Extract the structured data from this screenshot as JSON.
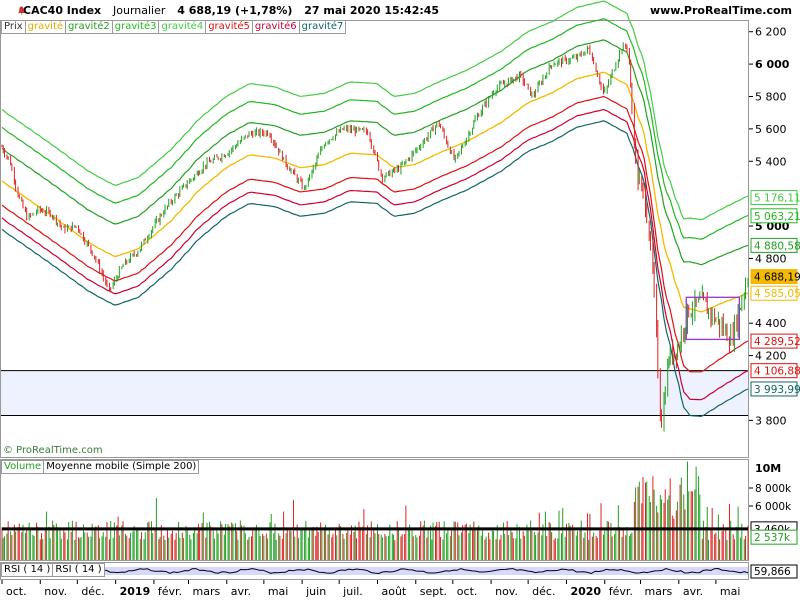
{
  "header": {
    "symbol": "CAC40 Index",
    "period": "Journalier",
    "last_price": "4 688,19 (+1,78%)",
    "datetime": "27 mai 2020 15:42:45",
    "site": "www.ProRealTime.com"
  },
  "price_legend": [
    {
      "label": "Prix",
      "color": "#333333"
    },
    {
      "label": "gravité",
      "color": "#e8a800"
    },
    {
      "label": "gravité2",
      "color": "#22a022"
    },
    {
      "label": "gravité3",
      "color": "#22b822"
    },
    {
      "label": "gravité4",
      "color": "#44cc44"
    },
    {
      "label": "gravité5",
      "color": "#dd1111"
    },
    {
      "label": "gravité6",
      "color": "#cc0033"
    },
    {
      "label": "gravité7",
      "color": "#116666"
    }
  ],
  "watermark": "© ProRealTime.com",
  "volume_legend": [
    {
      "label": "Volume",
      "color": "#22a022"
    },
    {
      "label": "Moyenne mobile (Simple 200)",
      "color": "#000000"
    }
  ],
  "rsi_legend": [
    {
      "label": "RSI ( 14 )",
      "color": "#000000"
    },
    {
      "label": "RSI ( 14 )",
      "color": "#000000"
    }
  ],
  "colors": {
    "bull": "#22a022",
    "bear": "#dd2222",
    "band_fill": "#eef2ff",
    "up3": "#44cc44",
    "up2": "#22b822",
    "up1": "#22a022",
    "mid": "#f5b800",
    "dn1": "#dd1111",
    "dn2": "#cc0033",
    "dn3": "#116666",
    "rsi_band": "#d8d8ff"
  },
  "chart_data": {
    "type": "line",
    "x_axis": {
      "labels": [
        "oct.",
        "nov.",
        "déc.",
        "2019",
        "févr.",
        "mars",
        "avr.",
        "mai",
        "juin",
        "juil.",
        "août",
        "sept.",
        "oct.",
        "nov.",
        "déc.",
        "2020",
        "févr.",
        "mars",
        "avr.",
        "mai"
      ],
      "bold_labels": [
        "2019",
        "2020"
      ],
      "range": [
        "2018-10-01",
        "2020-05-27"
      ]
    },
    "price_axis": {
      "ylim": [
        3580,
        6260
      ],
      "ticks": [
        "6 200",
        "6 000",
        "5 800",
        "5 600",
        "5 400",
        "5 000",
        "4 800",
        "4 400",
        "4 200",
        "3 800"
      ],
      "bold_ticks": [
        "6 000",
        "5 000"
      ]
    },
    "tags": [
      {
        "text": "5 176,11",
        "value": 5176.11,
        "color": "#44cc44"
      },
      {
        "text": "5 063,21",
        "value": 5063.21,
        "color": "#22b822"
      },
      {
        "text": "4 880,58",
        "value": 4880.58,
        "color": "#22a022"
      },
      {
        "text": "4 688,19",
        "value": 4688.19,
        "color": "#f5b800",
        "filled": true
      },
      {
        "text": "4 585,05",
        "value": 4585.05,
        "color": "#f5b800"
      },
      {
        "text": "4 289,52",
        "value": 4289.52,
        "color": "#dd1111"
      },
      {
        "text": "4 106,88",
        "value": 4106.88,
        "color": "#dd1111"
      },
      {
        "text": "3 993,99",
        "value": 3993.99,
        "color": "#116666"
      }
    ],
    "support_zone": {
      "upper": 4106.88,
      "lower": 3830
    },
    "box": {
      "from": "2020-04-07",
      "to": "2020-05-20",
      "high": 4560,
      "low": 4300
    },
    "central_line": {
      "name": "gravité",
      "points": [
        [
          "2018-10-01",
          5280
        ],
        [
          "2018-10-20",
          5180
        ],
        [
          "2018-11-15",
          5040
        ],
        [
          "2018-12-10",
          4900
        ],
        [
          "2019-01-01",
          4810
        ],
        [
          "2019-01-20",
          4860
        ],
        [
          "2019-02-15",
          5030
        ],
        [
          "2019-03-10",
          5220
        ],
        [
          "2019-04-01",
          5360
        ],
        [
          "2019-04-20",
          5440
        ],
        [
          "2019-05-10",
          5420
        ],
        [
          "2019-05-31",
          5360
        ],
        [
          "2019-06-20",
          5380
        ],
        [
          "2019-07-10",
          5450
        ],
        [
          "2019-08-01",
          5440
        ],
        [
          "2019-08-15",
          5360
        ],
        [
          "2019-09-01",
          5380
        ],
        [
          "2019-09-20",
          5450
        ],
        [
          "2019-10-15",
          5530
        ],
        [
          "2019-11-10",
          5640
        ],
        [
          "2019-12-01",
          5760
        ],
        [
          "2019-12-20",
          5820
        ],
        [
          "2020-01-10",
          5910
        ],
        [
          "2020-02-01",
          5950
        ],
        [
          "2020-02-20",
          5870
        ],
        [
          "2020-03-05",
          5550
        ],
        [
          "2020-03-20",
          4900
        ],
        [
          "2020-04-05",
          4500
        ],
        [
          "2020-04-20",
          4470
        ],
        [
          "2020-05-05",
          4520
        ],
        [
          "2020-05-27",
          4585
        ]
      ]
    },
    "band_offsets": {
      "gravité4": [
        440,
        440,
        440,
        560,
        600
      ],
      "gravité3": [
        330,
        330,
        330,
        440,
        480
      ],
      "gravité2": [
        200,
        200,
        200,
        290,
        296
      ],
      "gravité5": [
        -150,
        -150,
        -150,
        -390,
        -295
      ],
      "gravité6": [
        -230,
        -230,
        -230,
        -560,
        -478
      ],
      "gravité7": [
        -300,
        -300,
        -300,
        -660,
        -591
      ]
    },
    "band_offset_dates": [
      "2018-10-01",
      "2020-02-20",
      "2020-03-05",
      "2020-04-10",
      "2020-05-27"
    ],
    "price_close": [
      [
        "2018-10-01",
        5490
      ],
      [
        "2018-10-08",
        5400
      ],
      [
        "2018-10-15",
        5180
      ],
      [
        "2018-10-22",
        5050
      ],
      [
        "2018-10-31",
        5100
      ],
      [
        "2018-11-10",
        5080
      ],
      [
        "2018-11-20",
        4980
      ],
      [
        "2018-12-01",
        5000
      ],
      [
        "2018-12-15",
        4820
      ],
      [
        "2018-12-27",
        4600
      ],
      [
        "2019-01-08",
        4760
      ],
      [
        "2019-01-20",
        4850
      ],
      [
        "2019-02-01",
        5000
      ],
      [
        "2019-02-15",
        5150
      ],
      [
        "2019-03-01",
        5270
      ],
      [
        "2019-03-15",
        5380
      ],
      [
        "2019-04-01",
        5450
      ],
      [
        "2019-04-20",
        5570
      ],
      [
        "2019-05-05",
        5580
      ],
      [
        "2019-05-20",
        5380
      ],
      [
        "2019-06-03",
        5230
      ],
      [
        "2019-06-20",
        5520
      ],
      [
        "2019-07-05",
        5600
      ],
      [
        "2019-07-25",
        5580
      ],
      [
        "2019-08-05",
        5300
      ],
      [
        "2019-08-20",
        5360
      ],
      [
        "2019-09-05",
        5500
      ],
      [
        "2019-09-20",
        5640
      ],
      [
        "2019-10-03",
        5400
      ],
      [
        "2019-10-20",
        5660
      ],
      [
        "2019-11-05",
        5850
      ],
      [
        "2019-11-25",
        5930
      ],
      [
        "2019-12-05",
        5800
      ],
      [
        "2019-12-20",
        6000
      ],
      [
        "2020-01-10",
        6040
      ],
      [
        "2020-01-20",
        6100
      ],
      [
        "2020-02-01",
        5810
      ],
      [
        "2020-02-15",
        6100
      ],
      [
        "2020-02-20",
        6110
      ],
      [
        "2020-02-28",
        5300
      ],
      [
        "2020-03-06",
        5140
      ],
      [
        "2020-03-12",
        4650
      ],
      [
        "2020-03-18",
        3760
      ],
      [
        "2020-03-24",
        4180
      ],
      [
        "2020-04-01",
        4250
      ],
      [
        "2020-04-09",
        4480
      ],
      [
        "2020-04-20",
        4530
      ],
      [
        "2020-05-04",
        4400
      ],
      [
        "2020-05-14",
        4300
      ],
      [
        "2020-05-27",
        4688
      ]
    ],
    "volume_axis": {
      "ylim": [
        0,
        11000000
      ],
      "ticks": [
        "8 000k",
        "6 000k"
      ],
      "title": "10M",
      "tags": [
        {
          "text": "3 460k",
          "value": 3460000,
          "color": "#000000"
        },
        {
          "text": "2 537k",
          "value": 2537000,
          "color": "#22a022"
        }
      ]
    },
    "volume_ma_level": 3460000,
    "rsi_tag": "59,866"
  }
}
